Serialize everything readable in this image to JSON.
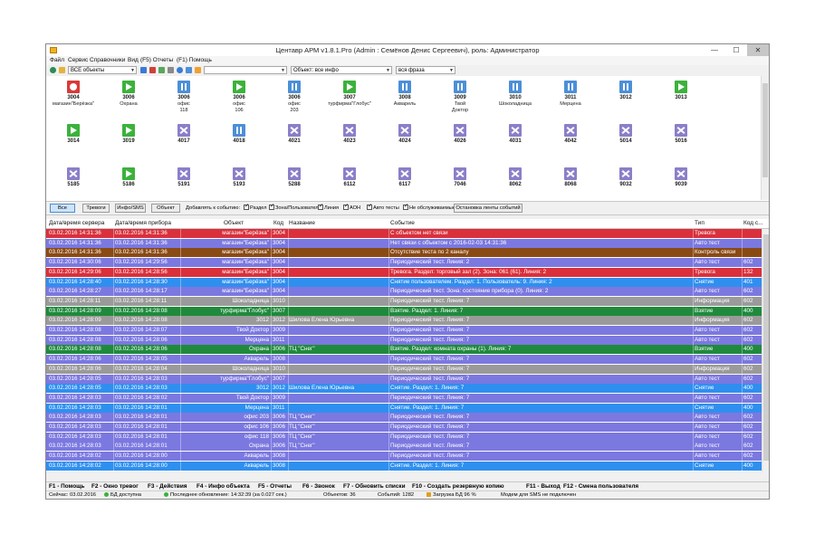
{
  "window": {
    "title": "Центавр АРМ v1.8.1.Pro (Admin : Семёнов Денис Сергеевич), роль: Администратор",
    "min": "—",
    "max": "☐",
    "close": "✕"
  },
  "menu": [
    "Файл",
    "Сервис",
    "Справочники",
    "Вид",
    "(F5) Отчеты",
    "(F1) Помощь"
  ],
  "toolbar": {
    "objects_combo": "ВСЕ объекты",
    "search_combo": "",
    "object_filter": "Объект: все инфо",
    "phrase_filter": "вся фраза"
  },
  "tiles": [
    {
      "num": "3004",
      "name": "магазин\"Берёзка\"",
      "icon": "alarm"
    },
    {
      "num": "3006",
      "name": "Охрана",
      "icon": "play"
    },
    {
      "num": "3006",
      "name": "офис\n118",
      "icon": "pause"
    },
    {
      "num": "3006",
      "name": "офис\n106",
      "icon": "play"
    },
    {
      "num": "3006",
      "name": "офис\n203",
      "icon": "pause"
    },
    {
      "num": "3007",
      "name": "турфирма\"Глобус\"",
      "icon": "play"
    },
    {
      "num": "3008",
      "name": "Акварель",
      "icon": "pause"
    },
    {
      "num": "3009",
      "name": "Твой\nДоктор",
      "icon": "pause"
    },
    {
      "num": "3010",
      "name": "Шоколадница",
      "icon": "pause"
    },
    {
      "num": "3011",
      "name": "Мерцена",
      "icon": "pause"
    },
    {
      "num": "3012",
      "name": "",
      "icon": "pause"
    },
    {
      "num": "3013",
      "name": "",
      "icon": "play"
    },
    {
      "num": "3014",
      "name": "",
      "icon": "play"
    },
    {
      "num": "3019",
      "name": "",
      "icon": "play"
    },
    {
      "num": "4017",
      "name": "",
      "icon": "off"
    },
    {
      "num": "4018",
      "name": "",
      "icon": "pause"
    },
    {
      "num": "4021",
      "name": "",
      "icon": "off"
    },
    {
      "num": "4023",
      "name": "",
      "icon": "off"
    },
    {
      "num": "4024",
      "name": "",
      "icon": "off"
    },
    {
      "num": "4026",
      "name": "",
      "icon": "off"
    },
    {
      "num": "4031",
      "name": "",
      "icon": "off"
    },
    {
      "num": "4042",
      "name": "",
      "icon": "off"
    },
    {
      "num": "5014",
      "name": "",
      "icon": "off"
    },
    {
      "num": "5016",
      "name": "",
      "icon": "off"
    },
    {
      "num": "5185",
      "name": "",
      "icon": "off"
    },
    {
      "num": "5186",
      "name": "",
      "icon": "play"
    },
    {
      "num": "5191",
      "name": "",
      "icon": "off"
    },
    {
      "num": "5193",
      "name": "",
      "icon": "off"
    },
    {
      "num": "5288",
      "name": "",
      "icon": "off"
    },
    {
      "num": "6112",
      "name": "",
      "icon": "off"
    },
    {
      "num": "6117",
      "name": "",
      "icon": "off"
    },
    {
      "num": "7046",
      "name": "",
      "icon": "off"
    },
    {
      "num": "8062",
      "name": "",
      "icon": "off"
    },
    {
      "num": "8068",
      "name": "",
      "icon": "off"
    },
    {
      "num": "9032",
      "name": "",
      "icon": "off"
    },
    {
      "num": "9039",
      "name": "",
      "icon": "off"
    }
  ],
  "filters": {
    "buttons": [
      "Все",
      "Тревоги",
      "Инфо/SMS",
      "Объект"
    ],
    "add_label": "Добавлять к событию:",
    "checks": [
      "Раздел",
      "Зона/Пользователь",
      "Линия",
      "АОН",
      "Авто тесты",
      "Не обслуживаемые"
    ],
    "stop_button": "Остановка ленты событий"
  },
  "columns": [
    "Дата/время сервера",
    "Дата/время прибора",
    "Объект",
    "Код",
    "Название",
    "Событие",
    "Тип",
    "Код с..."
  ],
  "colors": {
    "red": "#d9303c",
    "brown": "#8a4a14",
    "violet": "#7b78e0",
    "blue": "#2f8fef",
    "grey": "#9a9a9a",
    "green": "#1f8a3c"
  },
  "events": [
    {
      "s": "03.02.2016  14:31:36",
      "d": "03.02.2016  14:31:36",
      "obj": "магазин\"Берёзка\"",
      "code": "3004",
      "name": "",
      "ev": "С объектом нет связи",
      "type": "Тревога",
      "tc": "",
      "color": "red"
    },
    {
      "s": "03.02.2016  14:31:36",
      "d": "03.02.2016  14:31:36",
      "obj": "магазин\"Берёзка\"",
      "code": "3004",
      "name": "",
      "ev": "Нет связи с объектом с 2016-02-03 14:31:36",
      "type": "Авто тест",
      "tc": "",
      "color": "violet"
    },
    {
      "s": "03.02.2016  14:31:36",
      "d": "03.02.2016  14:31:36",
      "obj": "магазин\"Берёзка\"",
      "code": "3004",
      "name": "",
      "ev": "Отсутствие теста по 2 каналу",
      "type": "Контроль связи",
      "tc": "",
      "color": "brown"
    },
    {
      "s": "03.02.2016  14:30:06",
      "d": "03.02.2016  14:29:56",
      "obj": "магазин\"Берёзка\"",
      "code": "3004",
      "name": "",
      "ev": "Периодический тест. Линия: 2",
      "type": "Авто тест",
      "tc": "602",
      "color": "violet"
    },
    {
      "s": "03.02.2016  14:29:06",
      "d": "03.02.2016  14:28:56",
      "obj": "магазин\"Берёзка\"",
      "code": "3004",
      "name": "",
      "ev": "Тревога. Раздел: торговый зал (2). Зона: 061 (61). Линия: 2",
      "type": "Тревога",
      "tc": "132",
      "color": "red"
    },
    {
      "s": "03.02.2016  14:28:40",
      "d": "03.02.2016  14:28:30",
      "obj": "магазин\"Берёзка\"",
      "code": "3004",
      "name": "",
      "ev": "Снятие пользователем. Раздел: 1. Пользователь: 9. Линия: 2",
      "type": "Снятие",
      "tc": "401",
      "color": "blue"
    },
    {
      "s": "03.02.2016  14:28:27",
      "d": "03.02.2016  14:28:17",
      "obj": "магазин\"Берёзка\"",
      "code": "3004",
      "name": "",
      "ev": "Периодический тест. Зона: состояние прибора (0). Линия: 2",
      "type": "Авто тест",
      "tc": "602",
      "color": "violet"
    },
    {
      "s": "03.02.2016  14:28:11",
      "d": "03.02.2016  14:28:11",
      "obj": "Шоколадница",
      "code": "3010",
      "name": "",
      "ev": "Периодический тест. Линия: 7",
      "type": "Информация",
      "tc": "602",
      "color": "grey"
    },
    {
      "s": "03.02.2016  14:28:09",
      "d": "03.02.2016  14:28:08",
      "obj": "турфирма\"Глобус\"",
      "code": "3007",
      "name": "",
      "ev": "Взятие. Раздел: 1. Линия: 7",
      "type": "Взятие",
      "tc": "400",
      "color": "green"
    },
    {
      "s": "03.02.2016  14:28:09",
      "d": "03.02.2016  14:28:08",
      "obj": "3012",
      "code": "3012",
      "name": "Шилова Елена Юрьевна",
      "ev": "Периодический тест. Линия: 7",
      "type": "Информация",
      "tc": "602",
      "color": "grey"
    },
    {
      "s": "03.02.2016  14:28:08",
      "d": "03.02.2016  14:28:07",
      "obj": "Твой Доктор",
      "code": "3009",
      "name": "",
      "ev": "Периодический тест. Линия: 7",
      "type": "Авто тест",
      "tc": "602",
      "color": "violet"
    },
    {
      "s": "03.02.2016  14:28:08",
      "d": "03.02.2016  14:28:06",
      "obj": "Мерцена",
      "code": "3011",
      "name": "",
      "ev": "Периодический тест. Линия: 7",
      "type": "Авто тест",
      "tc": "602",
      "color": "violet"
    },
    {
      "s": "03.02.2016  14:28:08",
      "d": "03.02.2016  14:28:06",
      "obj": "Охрана",
      "code": "3006",
      "name": "ТЦ \"Снег\"",
      "ev": "Взятие. Раздел: комната охраны (1). Линия: 7",
      "type": "Взятие",
      "tc": "400",
      "color": "green"
    },
    {
      "s": "03.02.2016  14:28:06",
      "d": "03.02.2016  14:28:05",
      "obj": "Акварель",
      "code": "3008",
      "name": "",
      "ev": "Периодический тест. Линия: 7",
      "type": "Авто тест",
      "tc": "602",
      "color": "violet"
    },
    {
      "s": "03.02.2016  14:28:06",
      "d": "03.02.2016  14:28:04",
      "obj": "Шоколадница",
      "code": "3010",
      "name": "",
      "ev": "Периодический тест. Линия: 7",
      "type": "Информация",
      "tc": "602",
      "color": "grey"
    },
    {
      "s": "03.02.2016  14:28:05",
      "d": "03.02.2016  14:28:03",
      "obj": "турфирма\"Глобус\"",
      "code": "3007",
      "name": "",
      "ev": "Периодический тест. Линия: 7",
      "type": "Авто тест",
      "tc": "602",
      "color": "violet"
    },
    {
      "s": "03.02.2016  14:28:05",
      "d": "03.02.2016  14:28:03",
      "obj": "3012",
      "code": "3012",
      "name": "Шилова Елена Юрьевна",
      "ev": "Снятие. Раздел: 1. Линия: 7",
      "type": "Снятие",
      "tc": "400",
      "color": "blue"
    },
    {
      "s": "03.02.2016  14:28:03",
      "d": "03.02.2016  14:28:02",
      "obj": "Твой Доктор",
      "code": "3009",
      "name": "",
      "ev": "Периодический тест. Линия: 7",
      "type": "Авто тест",
      "tc": "602",
      "color": "violet"
    },
    {
      "s": "03.02.2016  14:28:03",
      "d": "03.02.2016  14:28:01",
      "obj": "Мерцена",
      "code": "3011",
      "name": "",
      "ev": "Снятие. Раздел: 1. Линия: 7",
      "type": "Снятие",
      "tc": "400",
      "color": "blue"
    },
    {
      "s": "03.02.2016  14:28:03",
      "d": "03.02.2016  14:28:01",
      "obj": "офис 203",
      "code": "3006",
      "name": "ТЦ \"Снег\"",
      "ev": "Периодический тест. Линия: 7",
      "type": "Авто тест",
      "tc": "602",
      "color": "violet"
    },
    {
      "s": "03.02.2016  14:28:03",
      "d": "03.02.2016  14:28:01",
      "obj": "офис 106",
      "code": "3006",
      "name": "ТЦ \"Снег\"",
      "ev": "Периодический тест. Линия: 7",
      "type": "Авто тест",
      "tc": "602",
      "color": "violet"
    },
    {
      "s": "03.02.2016  14:28:03",
      "d": "03.02.2016  14:28:01",
      "obj": "офис 118",
      "code": "3006",
      "name": "ТЦ \"Снег\"",
      "ev": "Периодический тест. Линия: 7",
      "type": "Авто тест",
      "tc": "602",
      "color": "violet"
    },
    {
      "s": "03.02.2016  14:28:03",
      "d": "03.02.2016  14:28:01",
      "obj": "Охрана",
      "code": "3006",
      "name": "ТЦ \"Снег\"",
      "ev": "Периодический тест. Линия: 7",
      "type": "Авто тест",
      "tc": "602",
      "color": "violet"
    },
    {
      "s": "03.02.2016  14:28:02",
      "d": "03.02.2016  14:28:00",
      "obj": "Акварель",
      "code": "3008",
      "name": "",
      "ev": "Периодический тест. Линия: 7",
      "type": "Авто тест",
      "tc": "602",
      "color": "violet"
    },
    {
      "s": "03.02.2016  14:28:02",
      "d": "03.02.2016  14:28:00",
      "obj": "Акварель",
      "code": "3008",
      "name": "",
      "ev": "Снятие. Раздел: 1. Линия: 7",
      "type": "Снятие",
      "tc": "400",
      "color": "blue"
    },
    {
      "s": "03.02.2016  14:28:00",
      "d": "03.02.2016  14:27:58",
      "obj": "Шоколадница",
      "code": "3010",
      "name": "",
      "ev": "Периодический тест. Линия: 7",
      "type": "Информация",
      "tc": "602",
      "color": "grey"
    }
  ],
  "hotkeys": [
    "F1 - Помощь",
    "F2 - Окно тревог",
    "F3 - Действия",
    "F4 - Инфо объекта",
    "F5 - Отчеты",
    "F6 - Звонок",
    "F7 - Обновить списки",
    "F10 - Создать резервную копию",
    "F11 - Выход",
    "F12 - Смена пользователя"
  ],
  "status": {
    "today": "Сейчас: 03.02.2016",
    "db": "БД доступна",
    "last_update": "Последнее обновление: 14:32:39 (за 0.027 сек.)",
    "objects": "Объектов: 36",
    "events": "Событий: 1282",
    "db_load": "Загрузка БД 96 %",
    "modem": "Модем для SMS не подключен"
  }
}
